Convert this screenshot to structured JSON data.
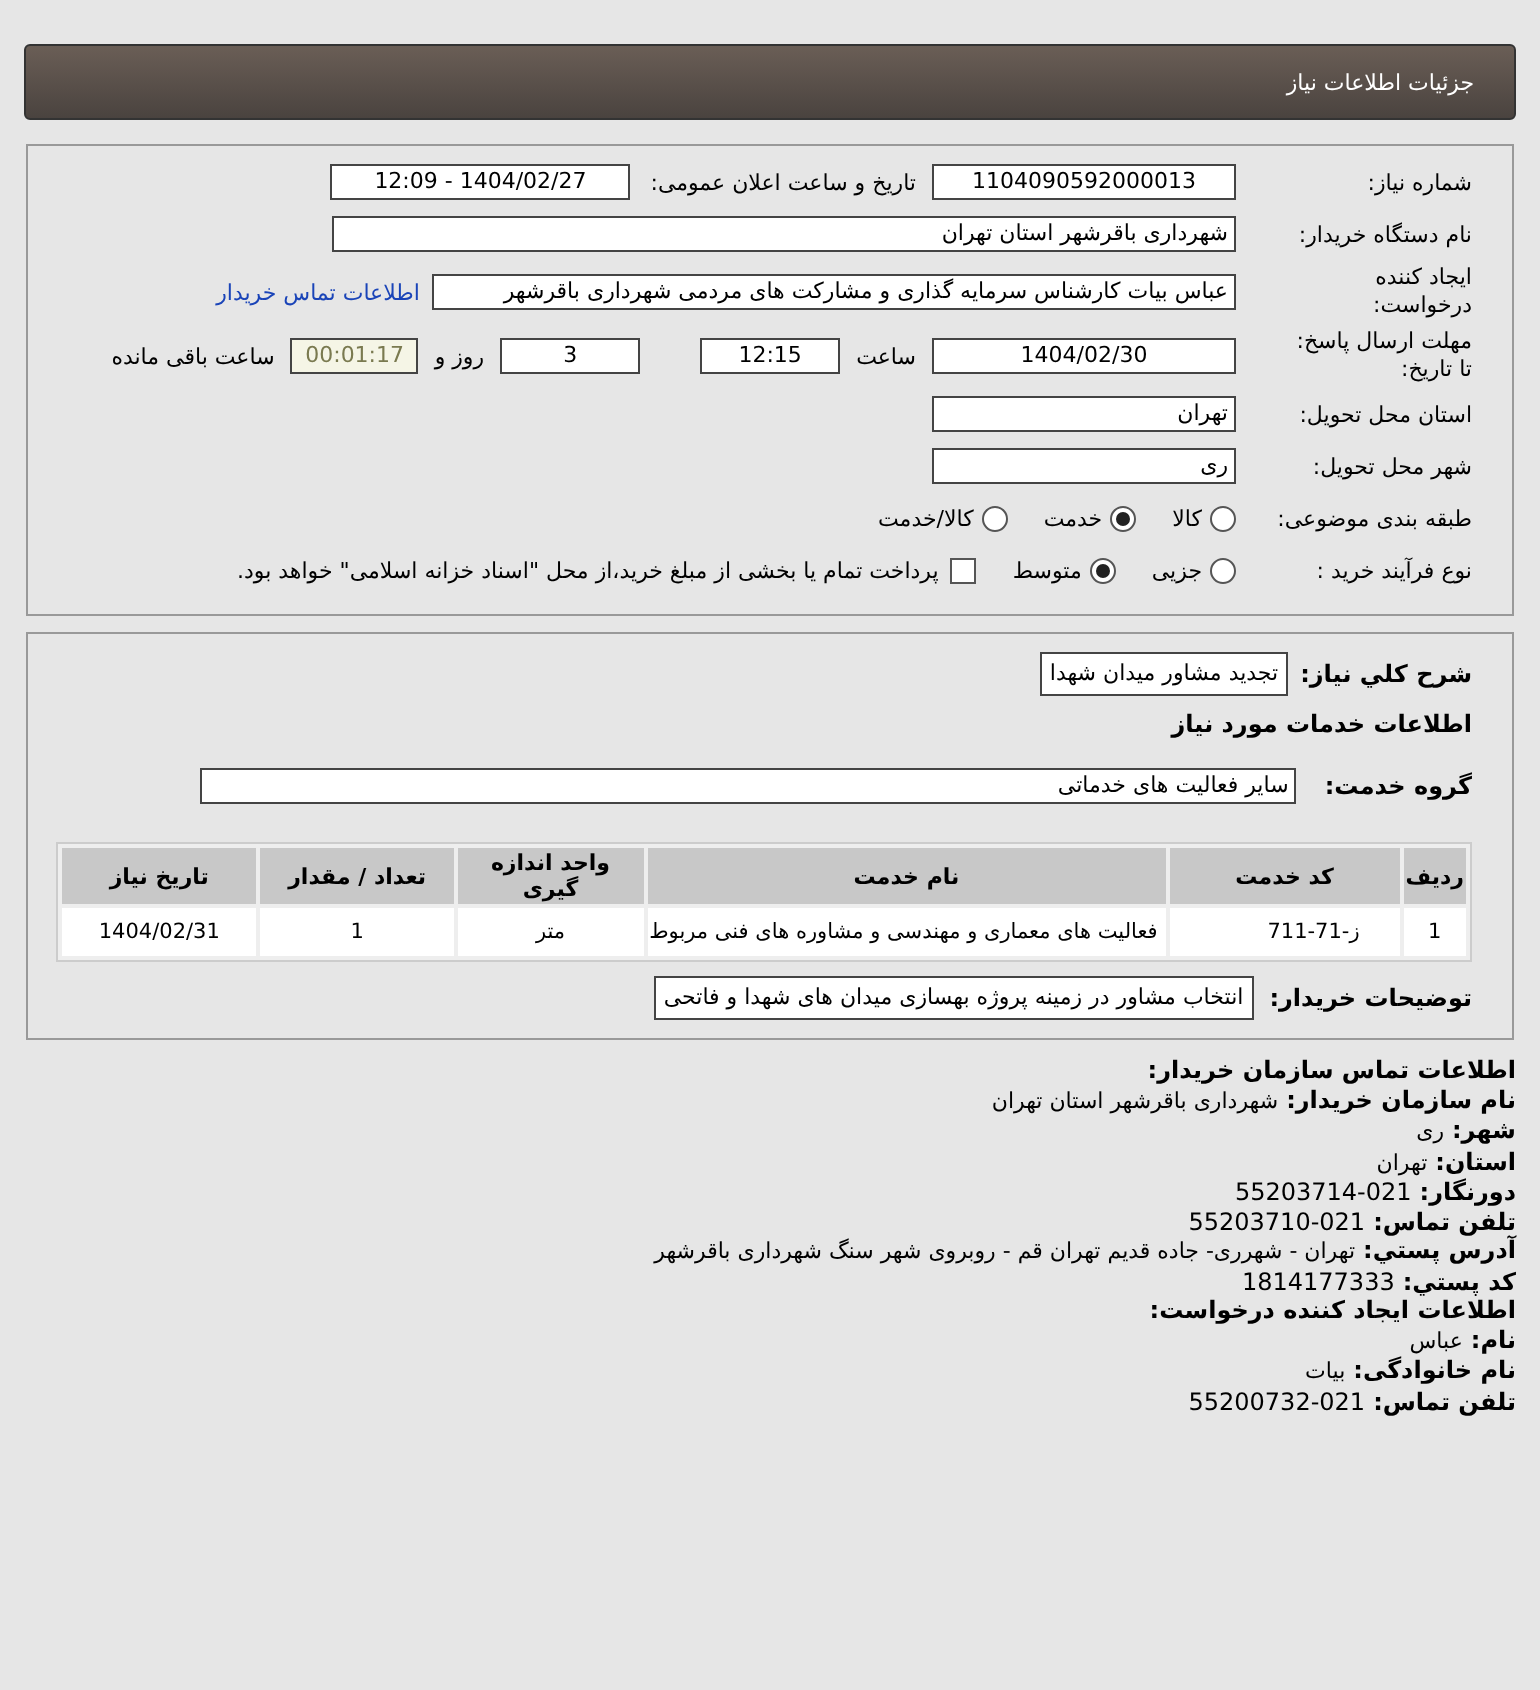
{
  "header": {
    "title": "جزئیات اطلاعات نیاز"
  },
  "details": {
    "need_number": {
      "label": "شماره نیاز:",
      "value": "1104090592000013"
    },
    "announce": {
      "label": "تاریخ و ساعت اعلان عمومی:",
      "value": "1404/02/27 - 12:09"
    },
    "buyer": {
      "label": "نام دستگاه خریدار:",
      "value": "شهرداری باقرشهر استان تهران"
    },
    "requester": {
      "label": "ایجاد کننده درخواست:",
      "value": "عباس بیات کارشناس سرمایه گذاری و مشارکت های مردمی شهرداری باقرشهر",
      "link": "اطلاعات تماس خریدار"
    },
    "deadline": {
      "label": "مهلت ارسال پاسخ: تا تاریخ:",
      "date": "1404/02/30",
      "time_label": "ساعت",
      "time": "12:15",
      "days": "3",
      "days_label": "روز و",
      "remaining": "00:01:17",
      "remaining_label": "ساعت باقی مانده"
    },
    "province": {
      "label": "استان محل تحویل:",
      "value": "تهران"
    },
    "city": {
      "label": "شهر محل تحویل:",
      "value": "ری"
    },
    "category": {
      "label": "طبقه بندی موضوعی:",
      "options": [
        {
          "label": "کالا",
          "selected": false
        },
        {
          "label": "خدمت",
          "selected": true
        },
        {
          "label": "کالا/خدمت",
          "selected": false
        }
      ]
    },
    "process": {
      "label": "نوع فرآیند خرید :",
      "options": [
        {
          "label": "جزیی",
          "selected": false
        },
        {
          "label": "متوسط",
          "selected": true
        }
      ],
      "payment": {
        "checked": false,
        "label": "پرداخت تمام یا بخشی از مبلغ خرید،از محل \"اسناد خزانه اسلامی\" خواهد بود."
      }
    }
  },
  "services": {
    "summary": {
      "label": "شرح کلي نیاز:",
      "value": "تجدید مشاور میدان شهدا"
    },
    "heading": "اطلاعات خدمات مورد نیاز",
    "group": {
      "label": "گروه خدمت:",
      "value": "سایر فعالیت های خدماتی"
    },
    "table": {
      "columns": [
        "ردیف",
        "کد خدمت",
        "نام خدمت",
        "واحد اندازه گیری",
        "تعداد / مقدار",
        "تاریخ نیاز"
      ],
      "rows": [
        [
          "1",
          "ز-71-711",
          "فعالیت های معماری و مهندسی و مشاوره های فنی مربوط",
          "متر",
          "1",
          "1404/02/31"
        ]
      ]
    },
    "notes": {
      "label": "توضیحات خریدار:",
      "value": "انتخاب مشاور در زمینه پروژه بهسازی میدان های شهدا و فاتحی"
    }
  },
  "contact": [
    {
      "kind": "heading",
      "label": "اطلاعات تماس سازمان خریدار:"
    },
    {
      "kind": "field",
      "label": "نام سازمان خریدار:",
      "value": "شهرداری باقرشهر استان تهران"
    },
    {
      "kind": "field",
      "label": "شهر:",
      "value": "ری"
    },
    {
      "kind": "field",
      "label": "استان:",
      "value": "تهران"
    },
    {
      "kind": "number",
      "label": "دورنگار:",
      "value": "55203714-021"
    },
    {
      "kind": "number",
      "label": "تلفن تماس:",
      "value": "55203710-021"
    },
    {
      "kind": "field",
      "label": "آدرس پستي:",
      "value": "تهران - شهرری- جاده قدیم تهران قم - روبروی شهر سنگ شهرداری باقرشهر"
    },
    {
      "kind": "number",
      "label": "کد پستي:",
      "value": "1814177333"
    },
    {
      "kind": "heading",
      "label": "اطلاعات ایجاد کننده درخواست:"
    },
    {
      "kind": "field",
      "label": "نام:",
      "value": "عباس"
    },
    {
      "kind": "field",
      "label": "نام خانوادگی:",
      "value": "بیات"
    },
    {
      "kind": "number",
      "label": "تلفن تماس:",
      "value": "55200732-021"
    }
  ]
}
